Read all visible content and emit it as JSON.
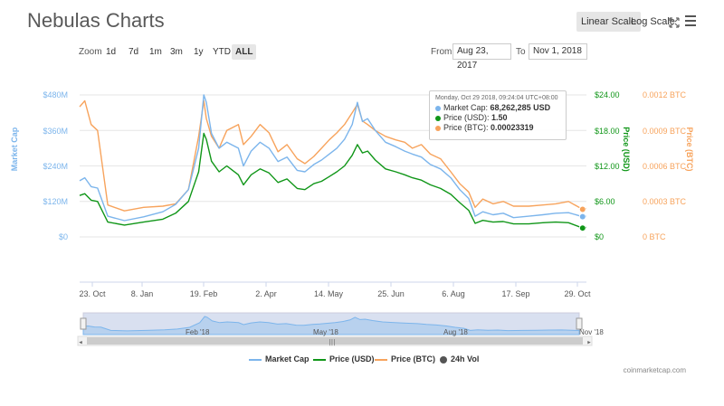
{
  "header": {
    "title": "Nebulas Charts",
    "linear_label": "Linear Scale",
    "log_label": "Log Scale"
  },
  "toolbar": {
    "zoom_label": "Zoom",
    "zoom_buttons": [
      "1d",
      "7d",
      "1m",
      "3m",
      "1y",
      "YTD",
      "ALL"
    ],
    "active_zoom": "ALL",
    "from_label": "From",
    "from_value": "Aug 23, 2017",
    "to_label": "To",
    "to_value": "Nov 1, 2018"
  },
  "colors": {
    "market_cap": "#7cb5ec",
    "price_usd": "#109618",
    "price_btc": "#f7a35c",
    "volume": "#555555"
  },
  "tooltip": {
    "time": "Monday, Oct 29 2018, 09:24:04 UTC+08:00",
    "market_cap_label": "Market Cap:",
    "market_cap_value": "68,262,285 USD",
    "price_usd_label": "Price (USD):",
    "price_usd_value": "1.50",
    "price_btc_label": "Price (BTC):",
    "price_btc_value": "0.00023319"
  },
  "navigator": {
    "labels": [
      "Feb '18",
      "May '18",
      "Aug '18",
      "Nov '18"
    ]
  },
  "legend": {
    "items": [
      "Market Cap",
      "Price (USD)",
      "Price (BTC)",
      "24h Vol"
    ]
  },
  "credits": "coinmarketcap.com",
  "chart_data": {
    "type": "line",
    "x_tick_labels": [
      "23. Oct",
      "8. Jan",
      "19. Feb",
      "2. Apr",
      "14. May",
      "25. Jun",
      "6. Aug",
      "17. Sep",
      "29. Oct"
    ],
    "y_axes": {
      "market_cap": {
        "title": "Market Cap",
        "ticks": [
          "$0",
          "$120M",
          "$240M",
          "$360M",
          "$480M"
        ],
        "range": [
          0,
          480000000
        ]
      },
      "price_usd": {
        "title": "Price (USD)",
        "ticks": [
          "$0",
          "$6.00",
          "$12.00",
          "$18.00",
          "$24.00"
        ],
        "range": [
          0,
          24
        ]
      },
      "price_btc": {
        "title": "Price (BTC)",
        "ticks": [
          "0 BTC",
          "0.0003 BTC",
          "0.0006 BTC",
          "0.0009 BTC",
          "0.0012 BTC"
        ],
        "range": [
          0,
          0.0012
        ]
      }
    },
    "x": [
      "2017-10-01",
      "2017-10-05",
      "2017-10-10",
      "2017-10-15",
      "2017-10-23",
      "2017-11-05",
      "2017-11-20",
      "2017-12-05",
      "2017-12-15",
      "2017-12-25",
      "2018-01-02",
      "2018-01-06",
      "2018-01-08",
      "2018-01-12",
      "2018-01-18",
      "2018-01-24",
      "2018-02-02",
      "2018-02-06",
      "2018-02-12",
      "2018-02-19",
      "2018-02-26",
      "2018-03-05",
      "2018-03-12",
      "2018-03-20",
      "2018-03-26",
      "2018-04-02",
      "2018-04-08",
      "2018-04-14",
      "2018-04-20",
      "2018-04-26",
      "2018-05-02",
      "2018-05-06",
      "2018-05-10",
      "2018-05-14",
      "2018-05-20",
      "2018-05-28",
      "2018-06-05",
      "2018-06-12",
      "2018-06-18",
      "2018-06-25",
      "2018-07-02",
      "2018-07-10",
      "2018-07-18",
      "2018-07-25",
      "2018-08-01",
      "2018-08-06",
      "2018-08-12",
      "2018-08-20",
      "2018-08-28",
      "2018-09-05",
      "2018-09-17",
      "2018-09-28",
      "2018-10-08",
      "2018-10-18",
      "2018-10-29",
      "2018-11-01"
    ],
    "series": [
      {
        "name": "Market Cap",
        "values": [
          190000000,
          200000000,
          170000000,
          165000000,
          70000000,
          55000000,
          68000000,
          85000000,
          110000000,
          160000000,
          300000000,
          480000000,
          455000000,
          350000000,
          300000000,
          320000000,
          300000000,
          240000000,
          290000000,
          320000000,
          300000000,
          255000000,
          270000000,
          225000000,
          220000000,
          245000000,
          260000000,
          280000000,
          300000000,
          330000000,
          380000000,
          455000000,
          390000000,
          400000000,
          360000000,
          320000000,
          305000000,
          290000000,
          280000000,
          270000000,
          245000000,
          230000000,
          200000000,
          160000000,
          130000000,
          70000000,
          85000000,
          75000000,
          80000000,
          65000000,
          70000000,
          75000000,
          80000000,
          82000000,
          68262285,
          70000000
        ]
      },
      {
        "name": "Price (USD)",
        "values": [
          7.0,
          7.3,
          6.2,
          6.0,
          2.5,
          2.0,
          2.5,
          3.0,
          4.0,
          6.0,
          11.0,
          17.5,
          16.5,
          12.8,
          11.0,
          12.0,
          10.5,
          8.8,
          10.5,
          11.5,
          10.8,
          9.2,
          9.8,
          8.2,
          8.0,
          9.0,
          9.4,
          10.2,
          11.0,
          12.0,
          13.8,
          15.6,
          14.2,
          14.5,
          13.0,
          11.5,
          11.0,
          10.5,
          10.0,
          9.6,
          8.8,
          8.2,
          7.2,
          5.8,
          4.5,
          2.3,
          2.8,
          2.5,
          2.6,
          2.2,
          2.2,
          2.4,
          2.5,
          2.4,
          1.5,
          1.6
        ]
      },
      {
        "name": "Price (BTC)",
        "values": [
          0.0011,
          0.00115,
          0.00095,
          0.0009,
          0.00027,
          0.00022,
          0.00025,
          0.00026,
          0.00028,
          0.0004,
          0.00085,
          0.00115,
          0.001,
          0.00085,
          0.00075,
          0.0009,
          0.00095,
          0.00078,
          0.00085,
          0.00095,
          0.00088,
          0.00072,
          0.00078,
          0.00066,
          0.00062,
          0.00068,
          0.00075,
          0.00082,
          0.00088,
          0.00095,
          0.00105,
          0.00112,
          0.00098,
          0.00095,
          0.0009,
          0.00085,
          0.00082,
          0.0008,
          0.00075,
          0.00078,
          0.0007,
          0.00066,
          0.00055,
          0.00045,
          0.00038,
          0.00025,
          0.00032,
          0.00028,
          0.0003,
          0.00026,
          0.00026,
          0.00027,
          0.00028,
          0.0003,
          0.00023319,
          0.00024
        ]
      }
    ],
    "grid": true,
    "legend_position": "bottom"
  }
}
